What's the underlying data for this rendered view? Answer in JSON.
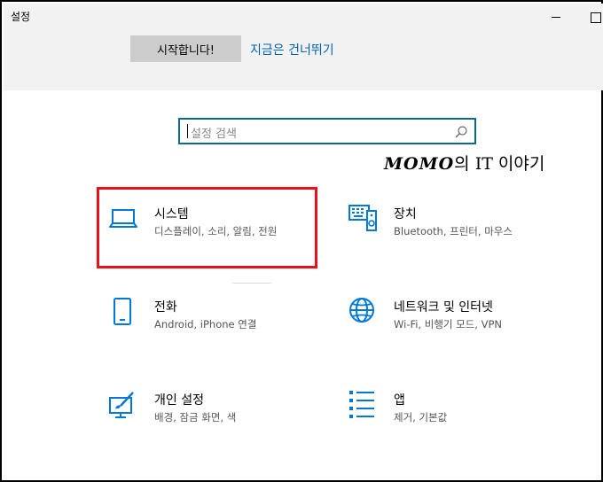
{
  "window": {
    "title": "설정"
  },
  "banner": {
    "start_label": "시작합니다!",
    "skip_label": "지금은 건너뛰기"
  },
  "search": {
    "placeholder": "설정 검색"
  },
  "watermark": {
    "brand": "MOMO",
    "text": "의 IT 이야기"
  },
  "tiles": [
    {
      "label": "시스템",
      "sub": "디스플레이, 소리, 알림, 전원",
      "icon": "laptop-icon"
    },
    {
      "label": "장치",
      "sub": "Bluetooth, 프린터, 마우스",
      "icon": "keyboard-device-icon"
    },
    {
      "label": "전화",
      "sub": "Android, iPhone 연결",
      "icon": "phone-icon"
    },
    {
      "label": "네트워크 및 인터넷",
      "sub": "Wi-Fi, 비행기 모드, VPN",
      "icon": "globe-icon"
    },
    {
      "label": "개인 설정",
      "sub": "배경, 잠금 화면, 색",
      "icon": "personalization-icon"
    },
    {
      "label": "앱",
      "sub": "제거, 기본값",
      "icon": "apps-list-icon"
    }
  ],
  "colors": {
    "accent": "#0063b1",
    "icon": "#0078d7",
    "highlight": "#e8101b"
  }
}
